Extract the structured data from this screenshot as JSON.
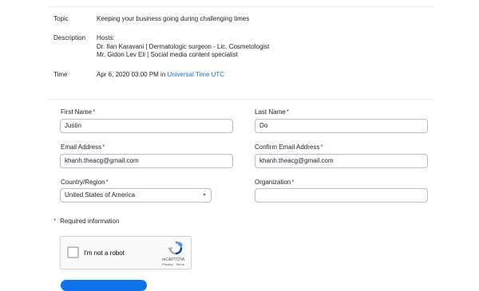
{
  "details": {
    "topic_label": "Topic",
    "topic_value": "Keeping your business going during challenging times",
    "description_label": "Description",
    "description_lines": [
      "Hosts:",
      "Dr. Ilan Karavani | Dermatologic surgeon - Lic. Cosmetologist",
      "Mr. Gidon Lev Eli | Social media content specialist"
    ],
    "time_label": "Time",
    "time_value": "Apr 6, 2020 03:00 PM in ",
    "time_zone_link": "Universal Time UTC"
  },
  "form": {
    "required_mark": "*",
    "first_name": {
      "label": "First Name",
      "value": "Justin"
    },
    "last_name": {
      "label": "Last Name",
      "value": "Do"
    },
    "email": {
      "label": "Email Address",
      "value": "khanh.theacg@gmail.com"
    },
    "confirm_email": {
      "label": "Confirm Email Address",
      "value": "khanh.theacg@gmail.com"
    },
    "country": {
      "label": "Country/Region",
      "value": "United States of America"
    },
    "organization": {
      "label": "Organization",
      "value": ""
    },
    "required_info": "Required information"
  },
  "recaptcha": {
    "label": "I'm not a robot",
    "brand": "reCAPTCHA",
    "links": "Privacy - Terms"
  },
  "colors": {
    "accent": "#0e72ed",
    "required": "#e02828",
    "text": "#232333"
  }
}
